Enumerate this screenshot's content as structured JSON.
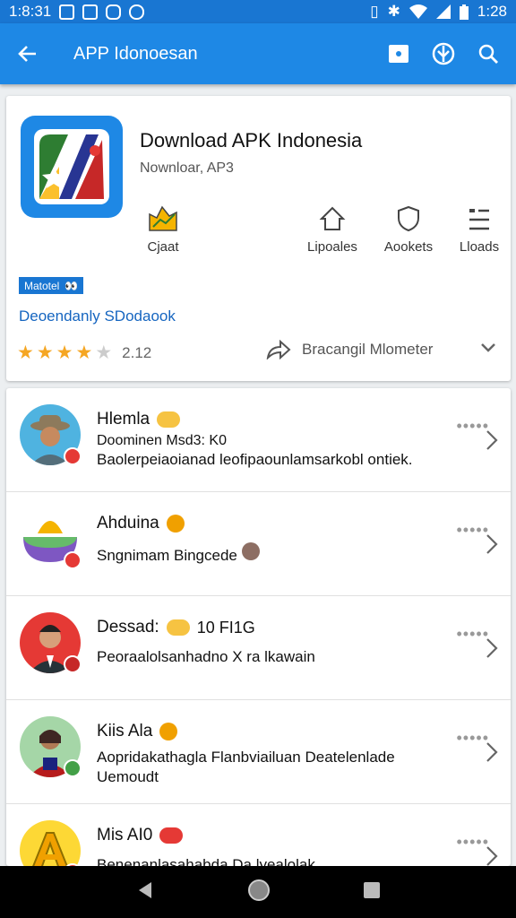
{
  "status": {
    "time_left": "1:8:31",
    "time_right": "1:28"
  },
  "appbar": {
    "title": "APP Idonoesan",
    "back_label": "←"
  },
  "app": {
    "name": "Download APK Indonesia",
    "subtitle": "Nownloar, AP3",
    "stats": [
      {
        "label": "Cjaat",
        "icon": "chart-icon"
      },
      {
        "label": "Lipoales",
        "icon": "home-icon"
      },
      {
        "label": "Aookets",
        "icon": "shield-icon"
      },
      {
        "label": "Lloads",
        "icon": "list-icon"
      }
    ],
    "badge": "Matotel",
    "developer": "Deoendanly SDodaook",
    "rating_value": "2.12",
    "rating_stars": 4,
    "share_label": "Bracangil Mlometer"
  },
  "reviews": [
    {
      "name": "Hlemla",
      "line2": "Doominen Msd3: K0",
      "line3": "Baolerpeiaoianad leofipaounlamsarkobl ontiek.",
      "more": "•••••",
      "badge_color": "#e53935",
      "avatar": "person-hat"
    },
    {
      "name": "Ahduina",
      "line2": "",
      "line3": "Sngnimam Bingcede",
      "more": "•••••",
      "badge_color": "#e53935",
      "avatar": "bowl"
    },
    {
      "name": "Dessad:",
      "name_extra": "10 FI1G",
      "line2": "",
      "line3": "Peoraalolsanhadno X ra lkawain",
      "more": "•••••",
      "badge_color": "#c62828",
      "avatar": "person-red"
    },
    {
      "name": "Kiis Ala",
      "line2": "",
      "line3": "Aopridakathagla Flanbviailuan Deatelenlade",
      "line4": "Uemoudt",
      "more": "•••••",
      "badge_color": "#43a047",
      "avatar": "person-green"
    },
    {
      "name": "Mis AI0",
      "line2": "",
      "line3": "Benenanlasahabda Da lyealolak",
      "more": "•••••",
      "badge_color": "#e53935",
      "avatar": "letter-a"
    }
  ],
  "colors": {
    "primary": "#1e88e5",
    "status": "#1976d2",
    "link": "#1565c0",
    "star": "#f5a623"
  }
}
